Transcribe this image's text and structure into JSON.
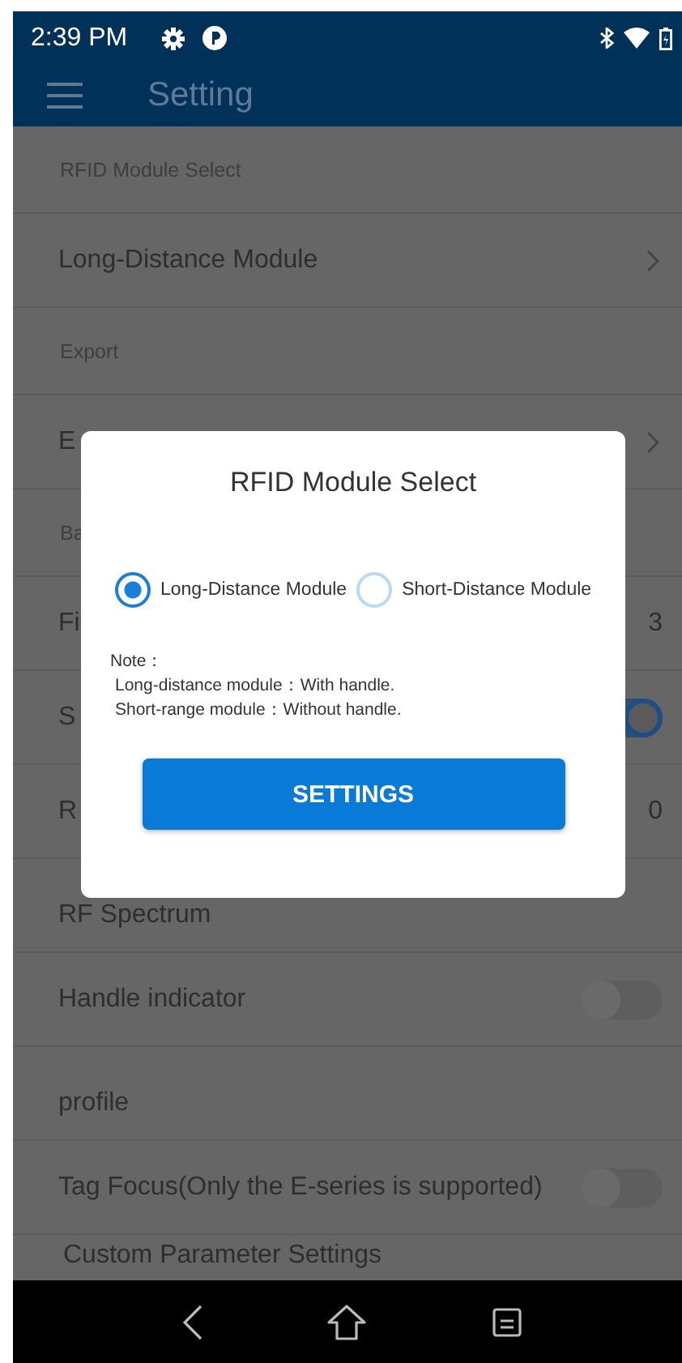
{
  "status_bar": {
    "time": "2:39 PM"
  },
  "app_bar": {
    "title": "Setting"
  },
  "settings": [
    {
      "kind": "header",
      "label": "RFID Module Select"
    },
    {
      "kind": "nav",
      "label": "Long-Distance Module"
    },
    {
      "kind": "header",
      "label": "Export"
    },
    {
      "kind": "nav",
      "label": "E"
    },
    {
      "kind": "header",
      "label": "Ba"
    },
    {
      "kind": "value",
      "label": "Fi",
      "value": "3"
    },
    {
      "kind": "toggle",
      "label": "S",
      "on": true
    },
    {
      "kind": "value",
      "label": "R",
      "value": "0"
    },
    {
      "kind": "plain",
      "label": "RF Spectrum"
    },
    {
      "kind": "toggle",
      "label": "Handle indicator",
      "on": false
    },
    {
      "kind": "plain",
      "label": "profile"
    },
    {
      "kind": "toggle",
      "label": "Tag Focus(Only the E-series is supported)",
      "on": false
    },
    {
      "kind": "last",
      "label": "Custom Parameter Settings"
    }
  ],
  "dialog": {
    "title": "RFID Module Select",
    "options": [
      {
        "label": "Long-Distance Module",
        "selected": true
      },
      {
        "label": "Short-Distance Module",
        "selected": false
      }
    ],
    "note": [
      "Note：",
      "Long-distance module：With handle.",
      "Short-range module：Without handle."
    ],
    "button": "SETTINGS"
  }
}
